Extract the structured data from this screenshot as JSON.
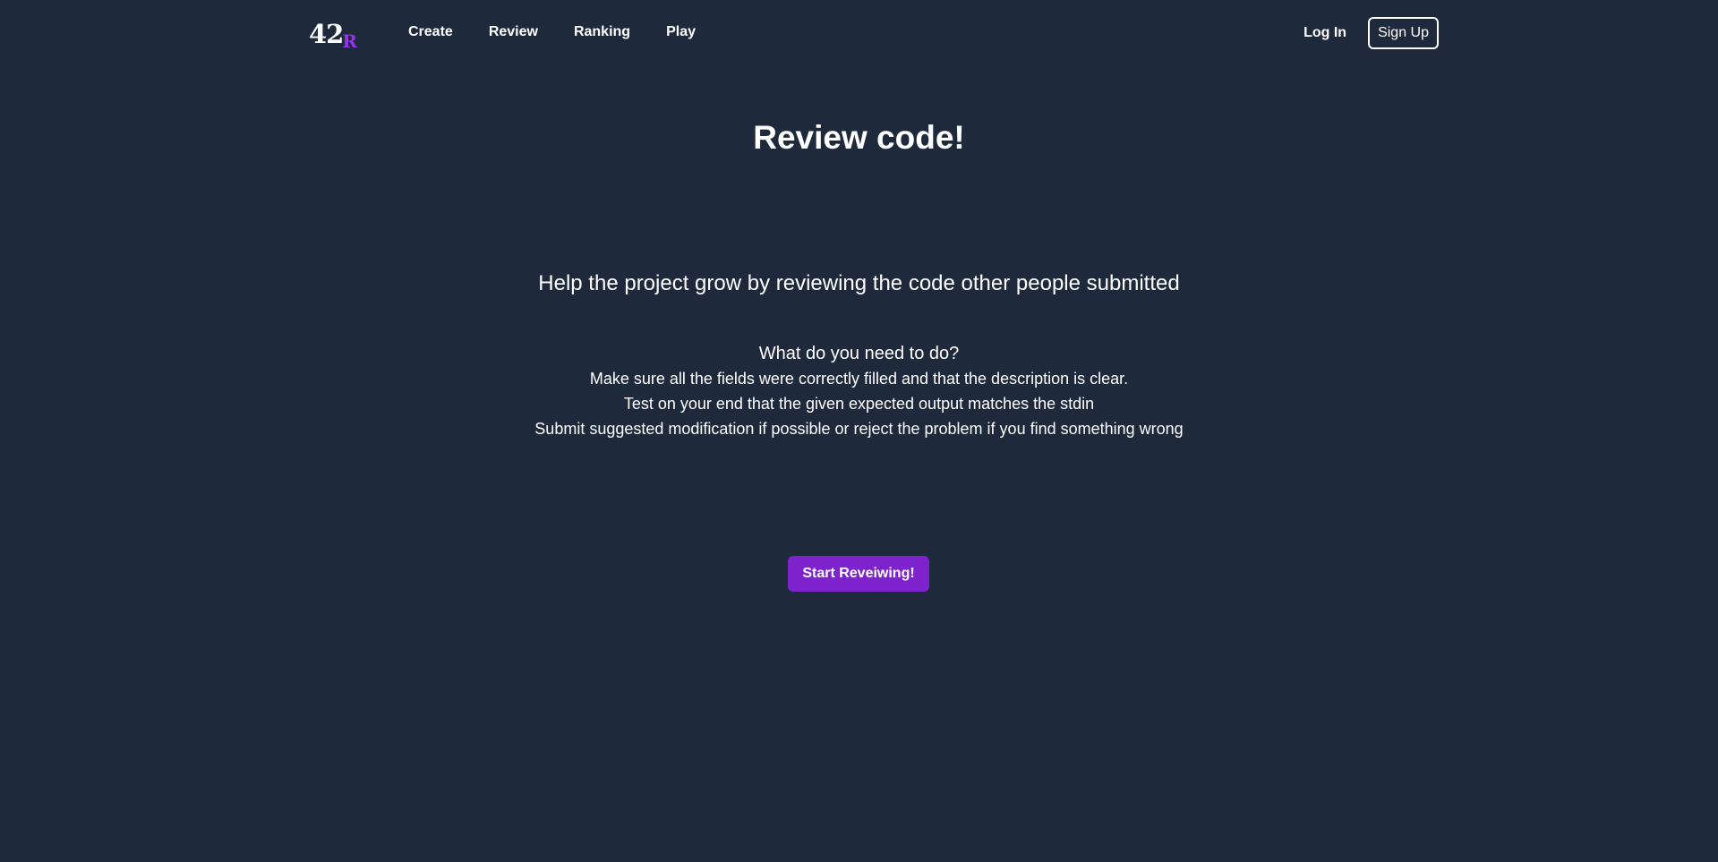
{
  "header": {
    "logo": {
      "main_text": "42",
      "accent_text": "R",
      "accent_color": "#9333ea"
    },
    "nav": [
      {
        "label": "Create"
      },
      {
        "label": "Review"
      },
      {
        "label": "Ranking"
      },
      {
        "label": "Play"
      }
    ],
    "login_label": "Log In",
    "signup_label": "Sign Up"
  },
  "main": {
    "title": "Review code!",
    "subtitle": "Help the project grow by reviewing the code other people submitted",
    "instructions": {
      "heading": "What do you need to do?",
      "lines": [
        "Make sure all the fields were correctly filled and that the description is clear.",
        "Test on your end that the given expected output matches the stdin",
        "Submit suggested modification if possible or reject the problem if you find something wrong"
      ]
    },
    "cta_label": "Start Reveiwing!"
  },
  "colors": {
    "background": "#1e293b",
    "accent": "#7e22ce",
    "text": "#ffffff"
  }
}
